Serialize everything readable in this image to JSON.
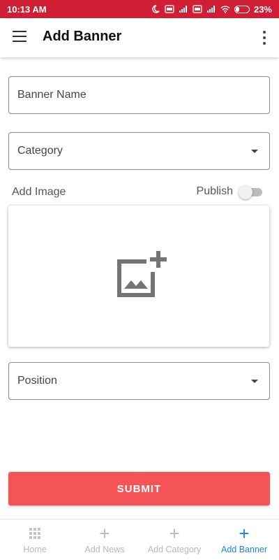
{
  "status_bar": {
    "time": "10:13 AM",
    "battery": "23%",
    "icons": [
      "moon-icon",
      "volte-icon",
      "signal-icon",
      "volte-icon",
      "signal-icon",
      "wifi-icon",
      "battery-icon"
    ]
  },
  "app_bar": {
    "title": "Add Banner",
    "menu_icon": "hamburger-menu-icon",
    "more_icon": "more-vertical-icon"
  },
  "form": {
    "banner_name_placeholder": "Banner Name",
    "category_label": "Category",
    "add_image_label": "Add Image",
    "publish_label": "Publish",
    "publish_on": false,
    "position_label": "Position",
    "submit_label": "SUBMIT"
  },
  "bottom_nav": {
    "items": [
      {
        "label": "Home",
        "icon": "grid-icon",
        "active": false
      },
      {
        "label": "Add News",
        "icon": "plus-icon",
        "active": false
      },
      {
        "label": "Add Category",
        "icon": "plus-icon",
        "active": false
      },
      {
        "label": "Add Banner",
        "icon": "plus-icon",
        "active": true
      }
    ]
  },
  "colors": {
    "status_bar": "#d01f35",
    "submit": "#f45455",
    "active_nav": "#1a86e2",
    "inactive_nav": "#b8b8b8"
  }
}
